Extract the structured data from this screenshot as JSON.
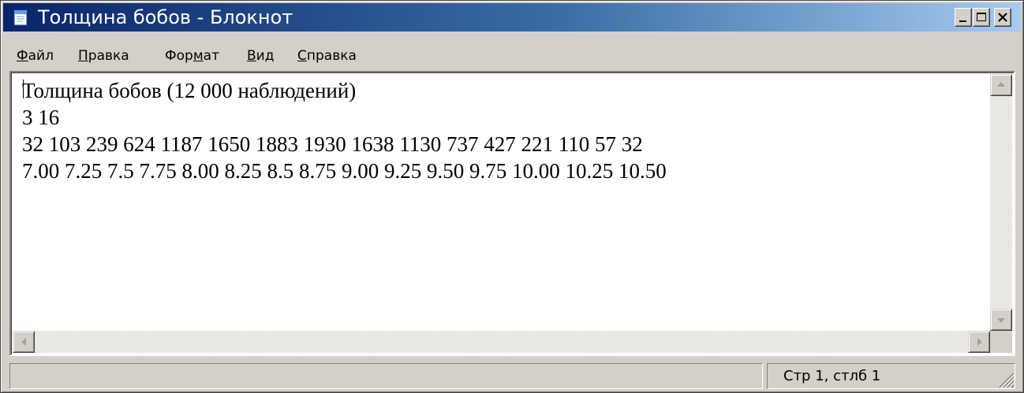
{
  "window": {
    "title": "Толщина бобов - Блокнот"
  },
  "menu": [
    {
      "accel": "Ф",
      "rest": "айл"
    },
    {
      "accel": "П",
      "rest": "равка"
    },
    {
      "pre": "Фор",
      "accel": "м",
      "rest": "ат"
    },
    {
      "accel": "В",
      "rest": "ид"
    },
    {
      "accel": "С",
      "rest": "правка"
    }
  ],
  "editor": {
    "lines": [
      "Толщина бобов (12 000 наблюдений)",
      "3 16",
      "32 103 239 624 1187 1650 1883 1930 1638 1130 737 427 221 110 57 32",
      "7.00 7.25 7.5 7.75 8.00 8.25 8.5 8.75 9.00 9.25 9.50 9.75 10.00 10.25 10.50"
    ]
  },
  "status": {
    "position": "Стр 1, стлб 1"
  },
  "icons": {
    "app": "notepad-icon",
    "minimize": "minimize-icon",
    "maximize": "maximize-icon",
    "close": "close-icon"
  }
}
